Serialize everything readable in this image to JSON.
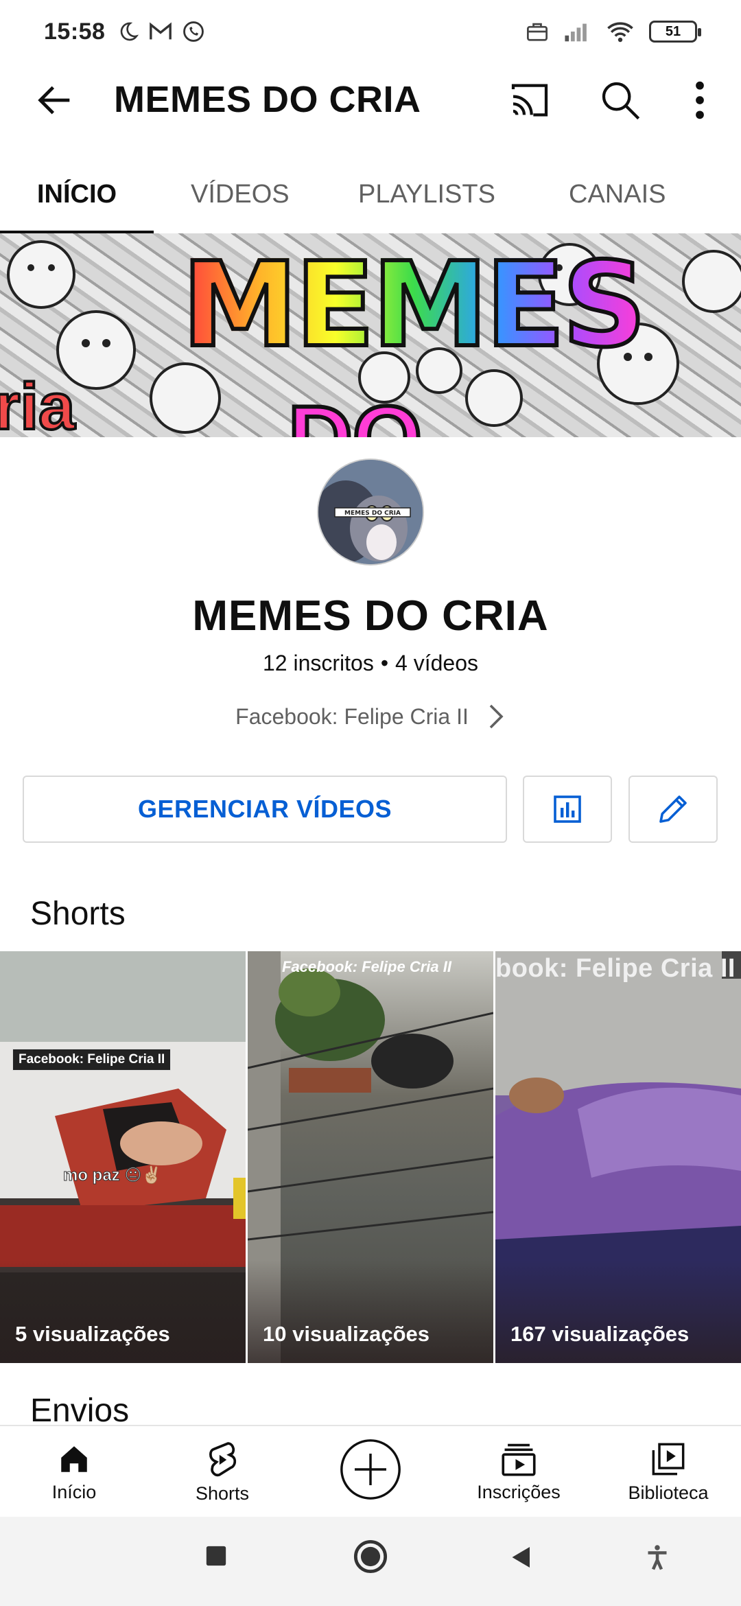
{
  "status_bar": {
    "time": "15:58",
    "left_icons": [
      "moon-icon",
      "gmail-icon",
      "whatsapp-icon"
    ],
    "right_icons": [
      "briefcase-icon",
      "signal-icon",
      "wifi-icon",
      "battery-icon"
    ],
    "battery": "51"
  },
  "app_bar": {
    "title": "MEMES DO CRIA",
    "icons": [
      "back-arrow-icon",
      "cast-icon",
      "search-icon",
      "more-vert-icon"
    ]
  },
  "tabs": [
    {
      "label": "INÍCIO",
      "active": true
    },
    {
      "label": "VÍDEOS",
      "active": false
    },
    {
      "label": "PLAYLISTS",
      "active": false
    },
    {
      "label": "CANAIS",
      "active": false
    }
  ],
  "banner": {
    "text": "MEMES",
    "text2": "DO",
    "text3": "ria"
  },
  "channel": {
    "avatar_text": "MEMES DO CRIA",
    "name": "MEMES DO CRIA",
    "subscribers": "12 inscritos",
    "separator": "•",
    "videos": "4 vídeos",
    "link": "Facebook: Felipe Cria II"
  },
  "actions": {
    "manage_label": "GERENCIAR VÍDEOS",
    "stats_icon": "analytics-icon",
    "edit_icon": "edit-pencil-icon"
  },
  "shorts_section": {
    "title": "Shorts",
    "items": [
      {
        "views": "5 visualizações",
        "watermark": "Facebook: Felipe Cria II",
        "caption": "mo paz 😐✌🏼"
      },
      {
        "views": "10 visualizações",
        "watermark": "Facebook: Felipe Cria II"
      },
      {
        "views": "167 visualizações",
        "watermark": "book: Felipe Cria II"
      }
    ]
  },
  "envios_section": {
    "title": "Envios"
  },
  "bottom_nav": [
    {
      "label": "Início",
      "icon": "home-icon",
      "active": true
    },
    {
      "label": "Shorts",
      "icon": "shorts-icon"
    },
    {
      "label": "",
      "icon": "create-plus-icon"
    },
    {
      "label": "Inscrições",
      "icon": "subscriptions-icon"
    },
    {
      "label": "Biblioteca",
      "icon": "library-icon"
    }
  ],
  "system_nav": [
    "recents-square-icon",
    "home-circle-icon",
    "back-triangle-icon",
    "accessibility-icon"
  ],
  "colors": {
    "accent": "#065fd4",
    "text": "#0f0f0f",
    "secondary": "#606060"
  }
}
